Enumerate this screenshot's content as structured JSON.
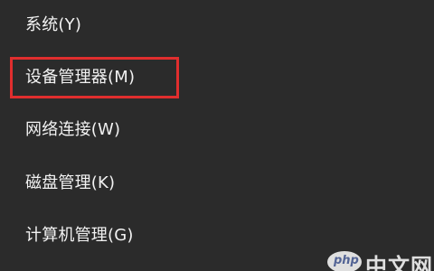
{
  "menu": {
    "items": [
      {
        "label": "系统(Y)"
      },
      {
        "label": "设备管理器(M)",
        "highlighted": true
      },
      {
        "label": "网络连接(W)"
      },
      {
        "label": "磁盘管理(K)"
      },
      {
        "label": "计算机管理(G)"
      }
    ]
  },
  "colors": {
    "menu_background": "#2b2b2b",
    "text": "#f2f2f2",
    "highlight_border": "#e02e2e"
  },
  "watermark": {
    "logo": "php",
    "text": "中文网"
  }
}
